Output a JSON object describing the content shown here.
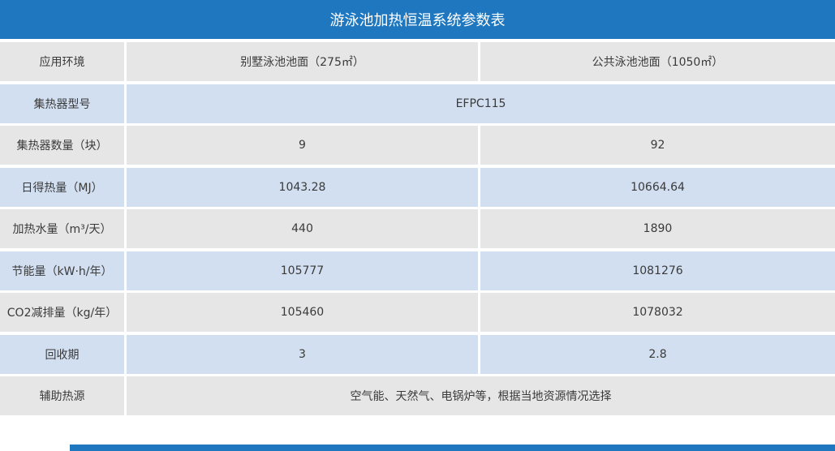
{
  "title": "游泳池加热恒温系统参数表",
  "rows": [
    {
      "label": "应用环境",
      "a": "别墅泳池池面（275㎡）",
      "b": "公共泳池池面（1050㎡）"
    },
    {
      "label": "集热器型号",
      "span": "EFPC115"
    },
    {
      "label": "集热器数量（块）",
      "a": "9",
      "b": "92"
    },
    {
      "label": "日得热量（MJ）",
      "a": "1043.28",
      "b": "10664.64"
    },
    {
      "label": "加热水量（m³/天）",
      "a": "440",
      "b": "1890"
    },
    {
      "label": "节能量（kW·h/年）",
      "a": "105777",
      "b": "1081276"
    },
    {
      "label": "CO2减排量（kg/年）",
      "a": "105460",
      "b": "1078032"
    },
    {
      "label": "回收期",
      "a": "3",
      "b": "2.8"
    },
    {
      "label": "辅助热源",
      "span": "空气能、天然气、电锅炉等，根据当地资源情况选择"
    }
  ],
  "colors": {
    "accent": "#1f78bf",
    "row_grey": "#e6e6e6",
    "row_blue": "#d2dff1",
    "text": "#3a3a3a"
  }
}
